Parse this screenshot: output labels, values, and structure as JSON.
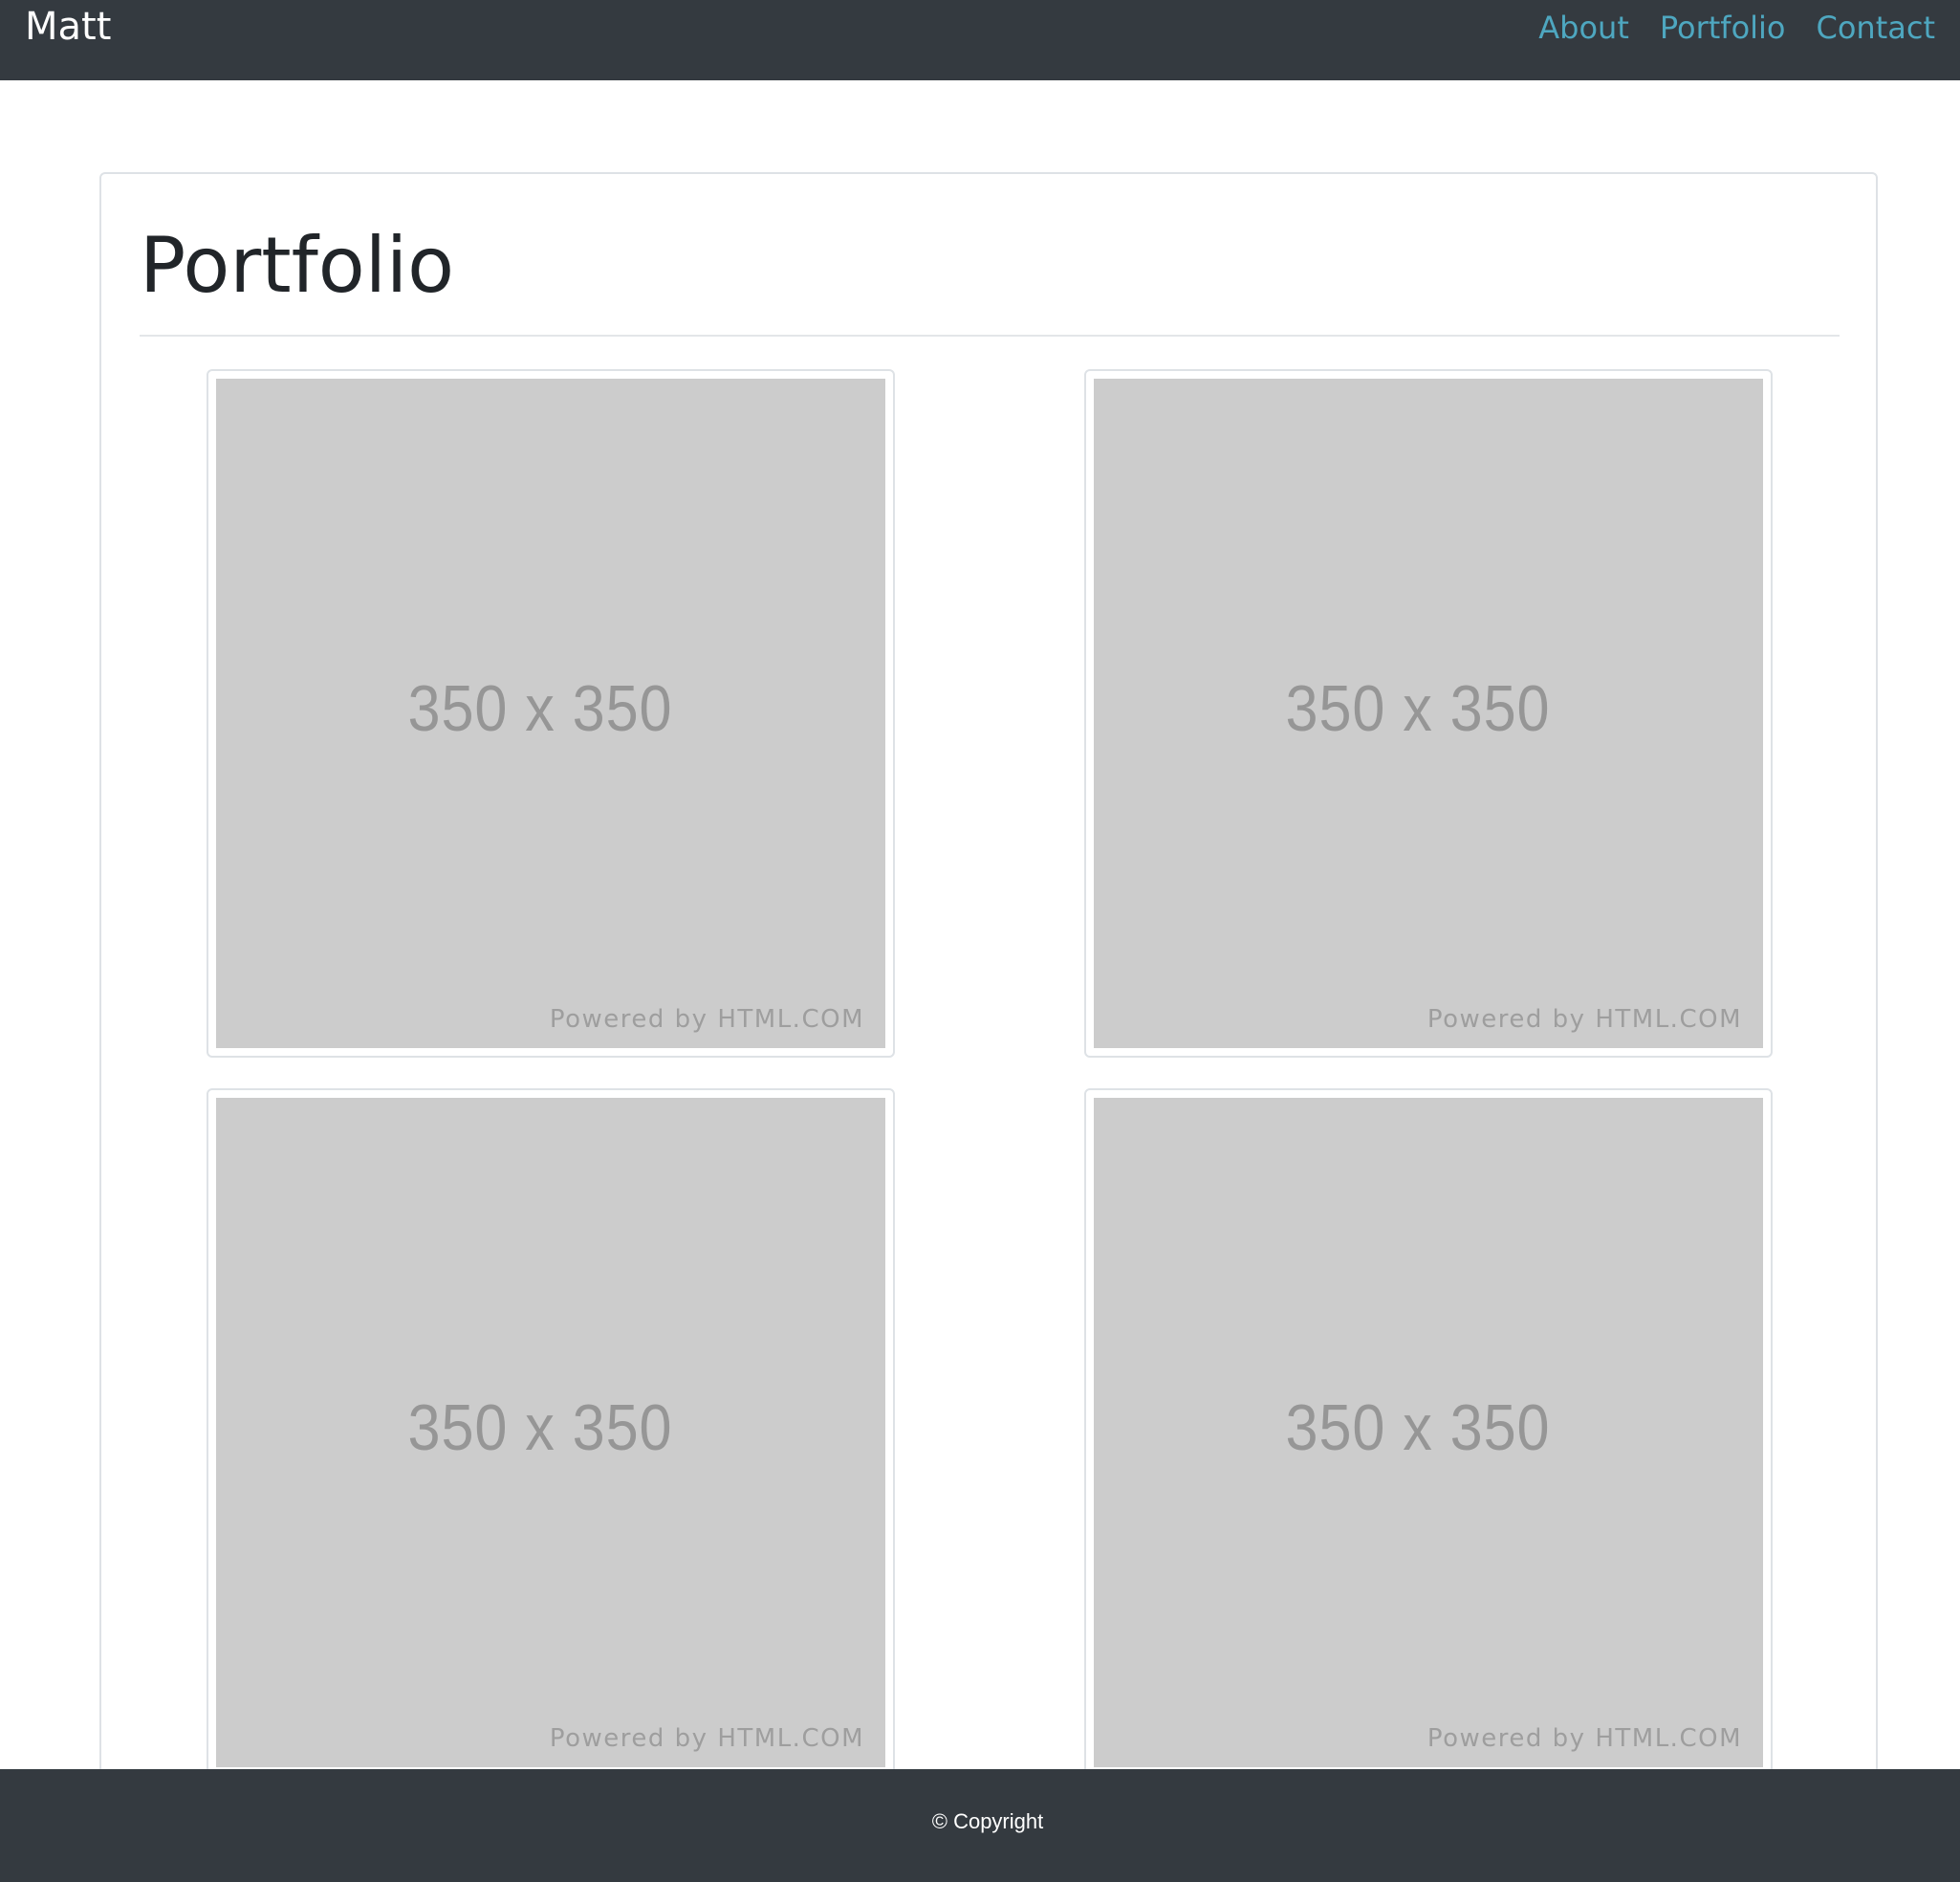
{
  "navbar": {
    "brand": "Matt",
    "links": [
      {
        "label": "About"
      },
      {
        "label": "Portfolio"
      },
      {
        "label": "Contact"
      }
    ]
  },
  "main": {
    "title": "Portfolio",
    "thumbnails": [
      {
        "dims": "350 x 350",
        "powered": "Powered by HTML.COM"
      },
      {
        "dims": "350 x 350",
        "powered": "Powered by HTML.COM"
      },
      {
        "dims": "350 x 350",
        "powered": "Powered by HTML.COM"
      },
      {
        "dims": "350 x 350",
        "powered": "Powered by HTML.COM"
      }
    ]
  },
  "footer": {
    "copyright": "© Copyright"
  },
  "colors": {
    "navbar_bg": "#343a40",
    "link": "#4ea7c0",
    "placeholder_bg": "#cccccc"
  }
}
